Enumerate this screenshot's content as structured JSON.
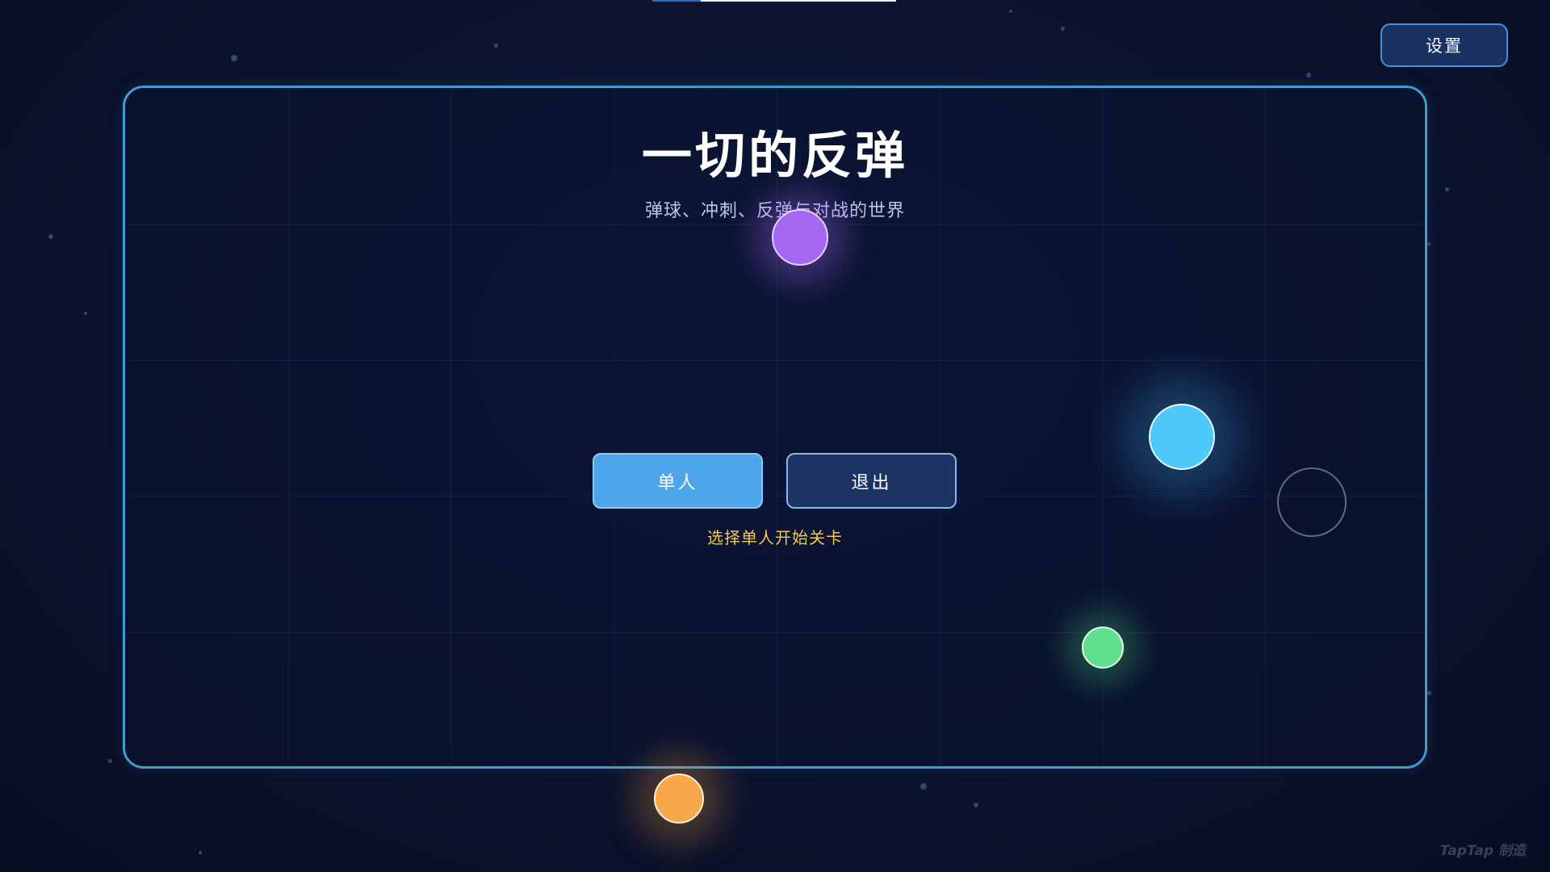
{
  "loading_bar": {
    "progress": 0.2
  },
  "header": {
    "settings_label": "设置"
  },
  "arena": {
    "title": "一切的反弹",
    "subtitle": "弹球、冲刺、反弹与对战的世界",
    "buttons": {
      "single_label": "单人",
      "exit_label": "退出"
    },
    "hint": "选择单人开始关卡"
  },
  "balls": [
    {
      "name": "purple-ball",
      "color": "#a468f0"
    },
    {
      "name": "cyan-ball",
      "color": "#4ec8f6"
    },
    {
      "name": "green-ball",
      "color": "#5fe08e"
    },
    {
      "name": "orange-ball",
      "color": "#f8a848"
    }
  ],
  "watermark": "TapTap 制造",
  "colors": {
    "background": "#0c1431",
    "arena_border": "#3e9ccf",
    "primary_button": "#4ea5ea",
    "secondary_button": "#1b3463",
    "hint_text": "#f2c94c"
  }
}
